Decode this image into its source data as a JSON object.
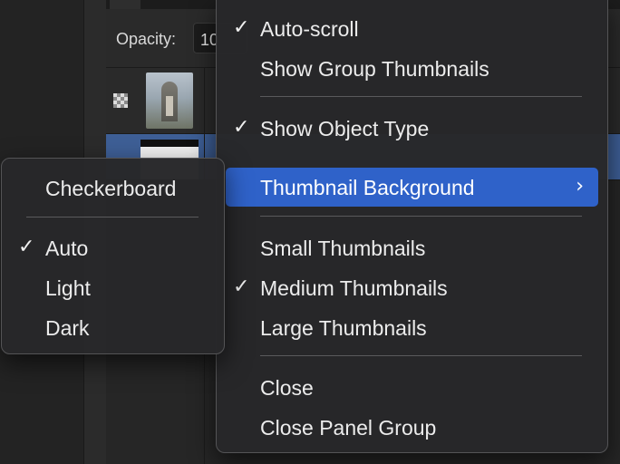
{
  "panel": {
    "opacity_label": "Opacity:",
    "opacity_value": "10"
  },
  "main_menu": {
    "items": [
      {
        "label": "Auto-scroll",
        "checked": true
      },
      {
        "label": "Show Group Thumbnails",
        "checked": false
      },
      {
        "label": "Show Object Type",
        "checked": true
      },
      {
        "label": "Thumbnail Background",
        "checked": false,
        "highlighted": true,
        "submenu": true
      },
      {
        "label": "Small Thumbnails",
        "checked": false
      },
      {
        "label": "Medium Thumbnails",
        "checked": true
      },
      {
        "label": "Large Thumbnails",
        "checked": false
      },
      {
        "label": "Close",
        "checked": false
      },
      {
        "label": "Close Panel Group",
        "checked": false
      }
    ],
    "check_glyph": "✓",
    "chevron_glyph": "›"
  },
  "sub_menu": {
    "items": [
      {
        "label": "Checkerboard",
        "checked": false
      },
      {
        "label": "Auto",
        "checked": true
      },
      {
        "label": "Light",
        "checked": false
      },
      {
        "label": "Dark",
        "checked": false
      }
    ]
  },
  "colors": {
    "highlight": "#2f62c9",
    "menu_bg": "#28282a",
    "selected_row": "#3e5f96"
  },
  "icons": {
    "check": "checkmark-icon",
    "submenu": "chevron-right-icon",
    "layer_visibility": "checkerboard-icon"
  }
}
